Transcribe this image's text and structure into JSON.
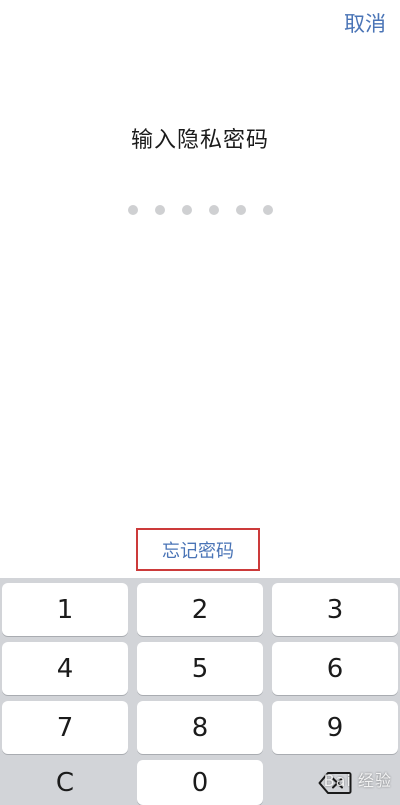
{
  "header": {
    "cancel_label": "取消"
  },
  "title": "输入隐私密码",
  "passcode": {
    "length": 6,
    "entered": 0
  },
  "forgot_label": "忘记密码",
  "keypad": {
    "keys": [
      "1",
      "2",
      "3",
      "4",
      "5",
      "6",
      "7",
      "8",
      "9",
      "C",
      "0"
    ],
    "delete_icon": "backspace-icon"
  },
  "watermark": "Bai 经验",
  "colors": {
    "accent": "#4a74b6",
    "highlight_border": "#cc3a3a",
    "keypad_bg": "#d2d4d8"
  }
}
